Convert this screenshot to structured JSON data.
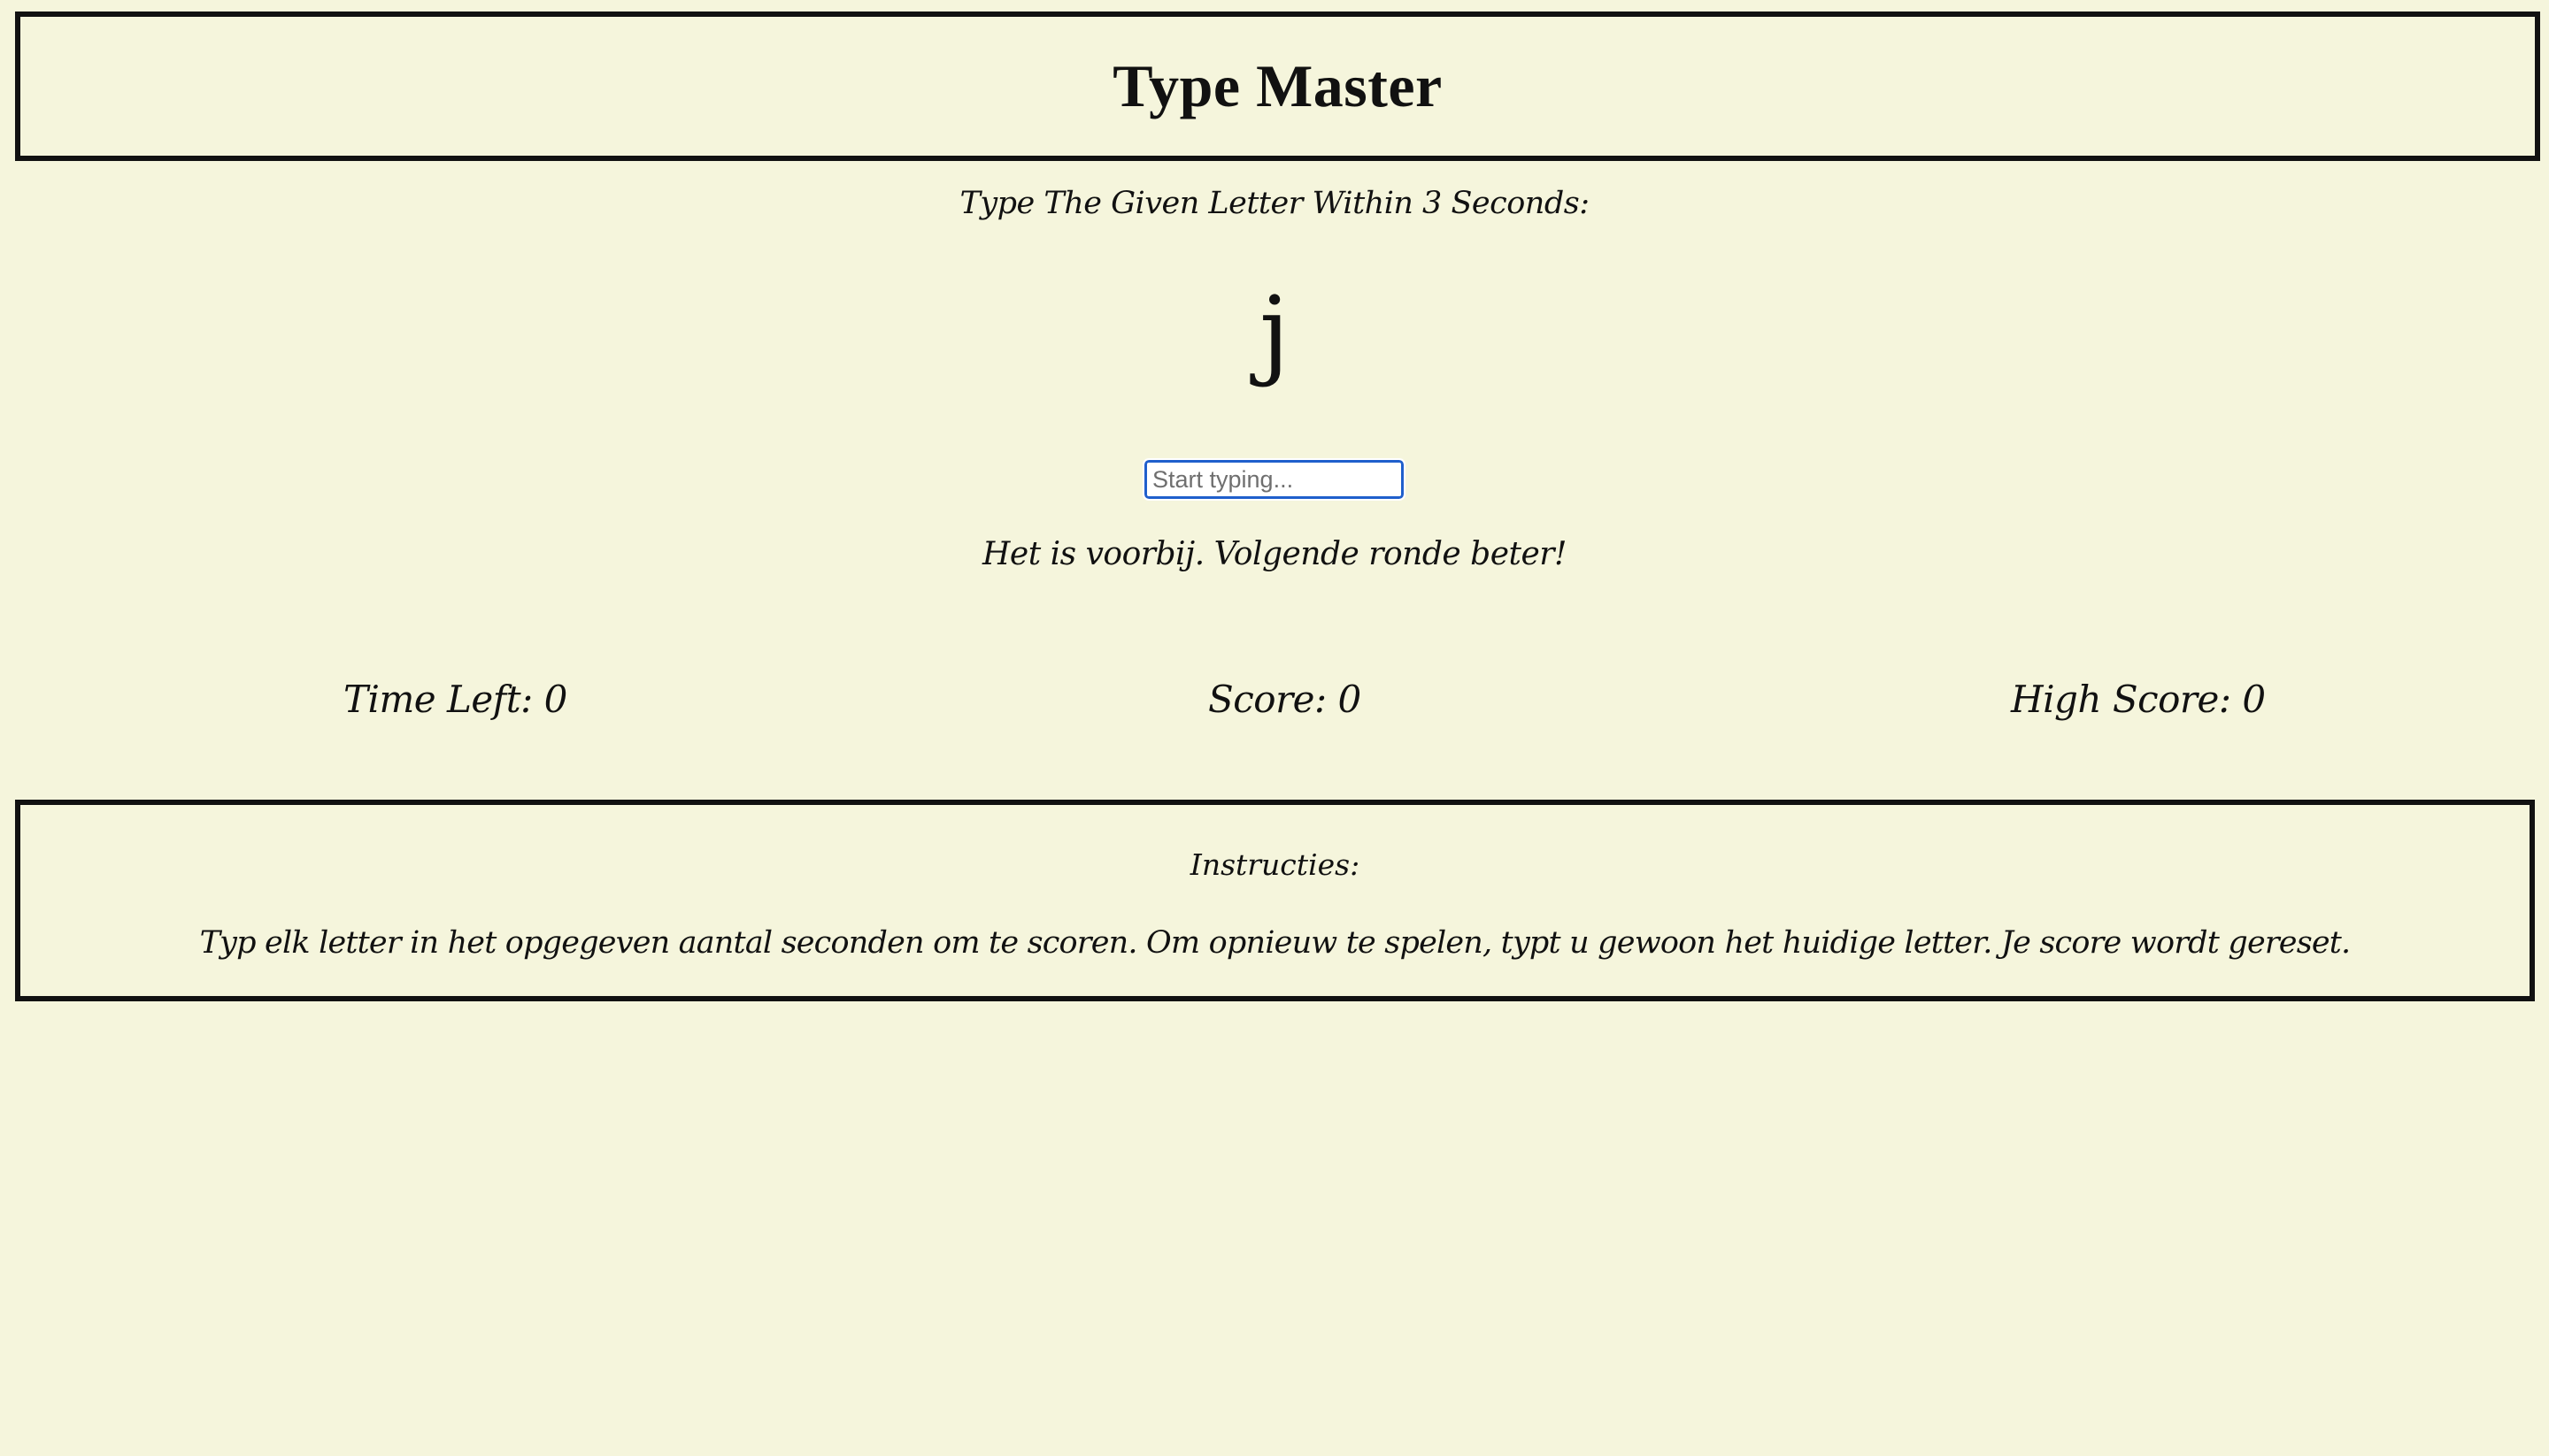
{
  "header": {
    "title": "Type Master"
  },
  "game": {
    "prompt": "Type The Given Letter Within 3 Seconds:",
    "current_letter": "j",
    "input": {
      "value": "",
      "placeholder": "Start typing..."
    },
    "message": "Het is voorbij. Volgende ronde beter!"
  },
  "stats": {
    "time_left": "Time Left: 0",
    "score": "Score: 0",
    "high_score": "High Score: 0"
  },
  "instructions": {
    "title": "Instructies:",
    "text": "Typ elk letter in het opgegeven aantal seconden om te scoren. Om opnieuw te spelen, typt u gewoon het huidige letter. Je score wordt gereset."
  }
}
